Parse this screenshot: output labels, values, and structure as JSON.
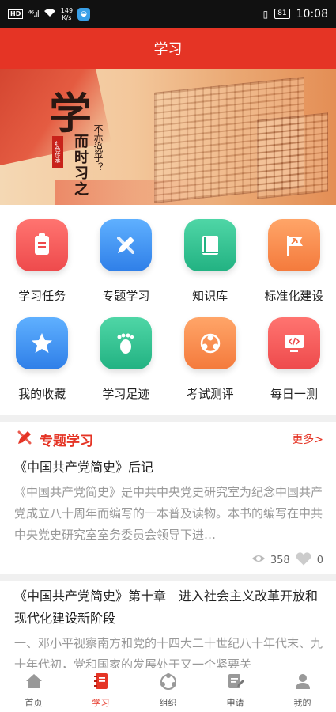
{
  "status_bar": {
    "hd": "HD",
    "signal": "⁴⁶.ıl",
    "speed_top": "149",
    "speed_bottom": "K/s",
    "battery": "81",
    "time": "10:08"
  },
  "header": {
    "title": "学习"
  },
  "banner": {
    "big_char": "学",
    "phrase": "而时习之",
    "sub_phrase": "不亦说乎？",
    "seal": "红色传承"
  },
  "grid": [
    {
      "label": "学习任务",
      "icon": "clipboard-icon",
      "color": "#f0585a"
    },
    {
      "label": "专题学习",
      "icon": "pencil-ruler-icon",
      "color": "#3c8ff0"
    },
    {
      "label": "知识库",
      "icon": "book-icon",
      "color": "#2dbf8e"
    },
    {
      "label": "标准化建设",
      "icon": "party-flag-icon",
      "color": "#f7894a"
    },
    {
      "label": "我的收藏",
      "icon": "star-icon",
      "color": "#3c8ff0"
    },
    {
      "label": "学习足迹",
      "icon": "footprint-icon",
      "color": "#2dbf8e"
    },
    {
      "label": "考试测评",
      "icon": "people-icon",
      "color": "#f7894a"
    },
    {
      "label": "每日一测",
      "icon": "code-monitor-icon",
      "color": "#f0585a"
    }
  ],
  "section": {
    "title": "专题学习",
    "more": "更多>"
  },
  "articles": [
    {
      "title": "《中国共产党简史》后记",
      "body": "《中国共产党简史》是中共中央党史研究室为纪念中国共产党成立八十周年而编写的一本普及读物。本书的编写在中共中央党史研究室室务委员会领导下进…",
      "views": "358",
      "likes": "0"
    },
    {
      "title": "《中国共产党简史》第十章　进入社会主义改革开放和现代化建设新阶段",
      "body": "一、邓小平视察南方和党的十四大二十世纪八十年代末、九十年代初，党和国家的发展处于又一个紧要关"
    }
  ],
  "tabs": [
    {
      "label": "首页",
      "icon": "home-icon"
    },
    {
      "label": "学习",
      "icon": "notebook-icon",
      "active": true
    },
    {
      "label": "组织",
      "icon": "organization-icon"
    },
    {
      "label": "申请",
      "icon": "application-icon"
    },
    {
      "label": "我的",
      "icon": "user-icon"
    }
  ]
}
